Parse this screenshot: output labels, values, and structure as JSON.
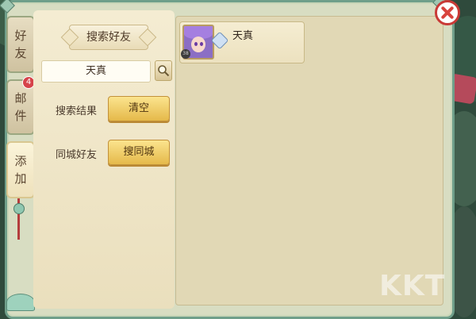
{
  "tabs": [
    {
      "label_line1": "好",
      "label_line2": "友"
    },
    {
      "label_line1": "邮",
      "label_line2": "件",
      "badge": "4"
    },
    {
      "label_line1": "添",
      "label_line2": "加"
    }
  ],
  "left_panel": {
    "title": "搜索好友",
    "search": {
      "value": "天真",
      "icon": "search-icon"
    },
    "search_result_label": "搜索结果",
    "clear_button": "清空",
    "same_city_label": "同城好友",
    "search_city_button": "搜同城"
  },
  "results": [
    {
      "name": "天真",
      "level": "38"
    }
  ],
  "colors": {
    "accent_gold": "#e5b94a",
    "close_red": "#c93a37",
    "frame_jade": "#6f9f8a"
  },
  "watermark": "KKT"
}
